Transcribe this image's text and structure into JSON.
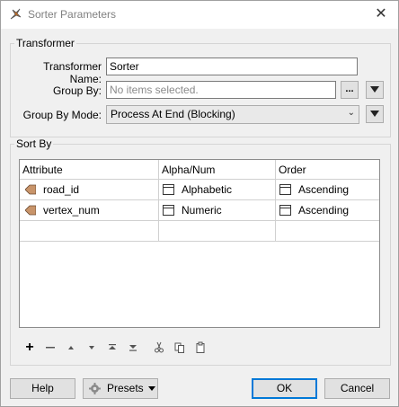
{
  "window": {
    "title": "Sorter Parameters",
    "close": "✕"
  },
  "transformer": {
    "legend": "Transformer",
    "name_label": "Transformer Name:",
    "name_value": "Sorter",
    "group_by_label": "Group By:",
    "group_by_placeholder": "No items selected.",
    "ellipsis": "...",
    "group_by_mode_label": "Group By Mode:",
    "group_by_mode_value": "Process At End (Blocking)"
  },
  "sort_by": {
    "legend": "Sort By",
    "columns": [
      "Attribute",
      "Alpha/Num",
      "Order"
    ],
    "rows": [
      {
        "attribute": "road_id",
        "alpha_num": "Alphabetic",
        "order": "Ascending"
      },
      {
        "attribute": "vertex_num",
        "alpha_num": "Numeric",
        "order": "Ascending"
      }
    ]
  },
  "toolbar": {
    "icons": [
      "plus-icon",
      "minus-icon",
      "move-up-icon",
      "move-down-icon",
      "move-top-icon",
      "move-bottom-icon",
      "cut-icon",
      "copy-icon",
      "paste-icon"
    ]
  },
  "buttons": {
    "help": "Help",
    "presets": "Presets",
    "ok": "OK",
    "cancel": "Cancel"
  },
  "colors": {
    "accent": "#0078d7",
    "attribute_icon": "#c8946a"
  }
}
